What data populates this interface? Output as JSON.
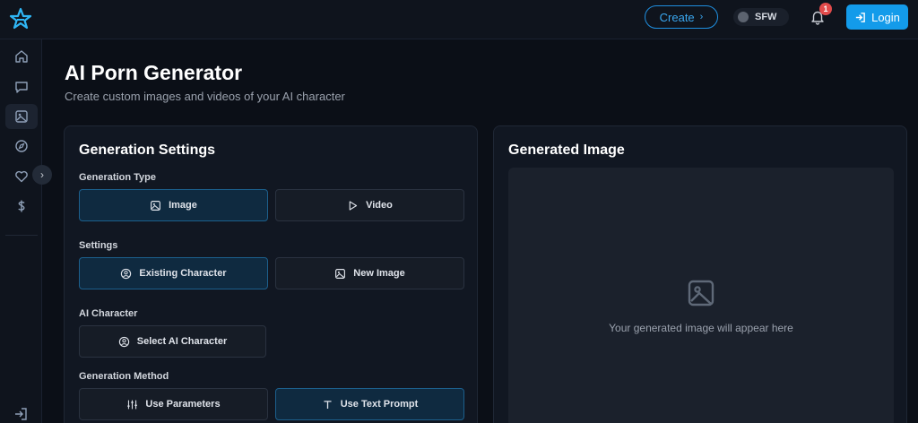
{
  "header": {
    "create_label": "Create",
    "sfw_label": "SFW",
    "notification_count": "1",
    "login_label": "Login"
  },
  "sidebar": {
    "items": [
      {
        "icon": "home-icon"
      },
      {
        "icon": "chat-icon"
      },
      {
        "icon": "image-icon",
        "active": true
      },
      {
        "icon": "compass-icon"
      },
      {
        "icon": "heart-icon"
      },
      {
        "icon": "dollar-icon"
      }
    ]
  },
  "page": {
    "title": "AI Porn Generator",
    "subtitle": "Create custom images and videos of your AI character"
  },
  "settings": {
    "title": "Generation Settings",
    "generation_type_label": "Generation Type",
    "type_image": "Image",
    "type_video": "Video",
    "settings_label": "Settings",
    "existing_character": "Existing Character",
    "new_image": "New Image",
    "ai_character_label": "AI Character",
    "select_character": "Select AI Character",
    "generation_method_label": "Generation Method",
    "use_parameters": "Use Parameters",
    "use_text_prompt": "Use Text Prompt"
  },
  "output": {
    "title": "Generated Image",
    "placeholder_text": "Your generated image will appear here"
  },
  "colors": {
    "accent": "#139bea",
    "background": "#0b0f17",
    "active_option": "#0f2a40"
  }
}
